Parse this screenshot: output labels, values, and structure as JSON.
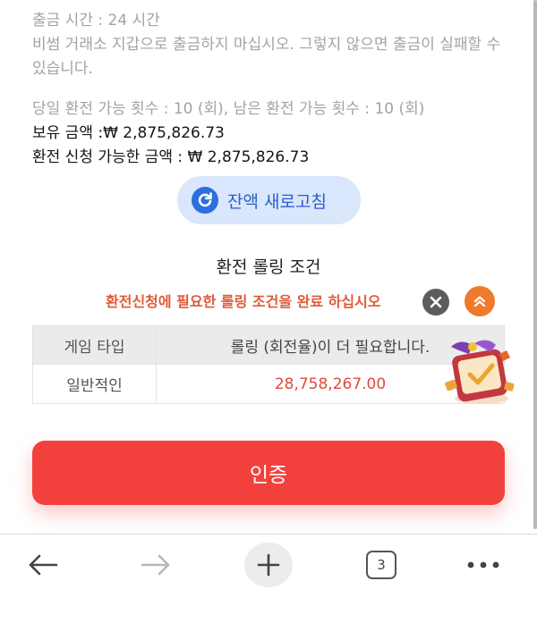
{
  "withdraw_info": {
    "time_line": "출금 시간 :  24 시간",
    "warning": "비썸 거래소 지갑으로 출금하지 마십시오. 그렇지 않으면 출금이 실패할 수 있습니다.",
    "count_line": "당일 환전 가능 횟수 : 10 (회), 남은 환전 가능 횟수 : 10 (회)",
    "balance_line": "보유 금액 :₩ 2,875,826.73",
    "available_line": "환전 신청 가능한 금액 : ₩ 2,875,826.73"
  },
  "refresh_button": {
    "label": "잔액 새로고침",
    "icon": "refresh-icon"
  },
  "rolling": {
    "title": "환전 롤링 조건",
    "notice": "환전신청에 필요한 롤링 조건을 완료 하십시오",
    "table": {
      "headers": [
        "게임 타입",
        "롤링 (회전율)이 더 필요합니다."
      ],
      "rows": [
        {
          "game_type": "일반적인",
          "amount": "28,758,267.00"
        }
      ]
    }
  },
  "verify_button": {
    "label": "인증"
  },
  "browser_toolbar": {
    "tab_count": "3",
    "icons": [
      "back-arrow-icon",
      "forward-arrow-icon",
      "plus-icon",
      "tabs-icon",
      "more-icon"
    ]
  },
  "colors": {
    "accent_red": "#f2413d",
    "notice_orange": "#de5a3a",
    "refresh_blue": "#2c6fe0",
    "refresh_bg": "#d9e6fb"
  }
}
